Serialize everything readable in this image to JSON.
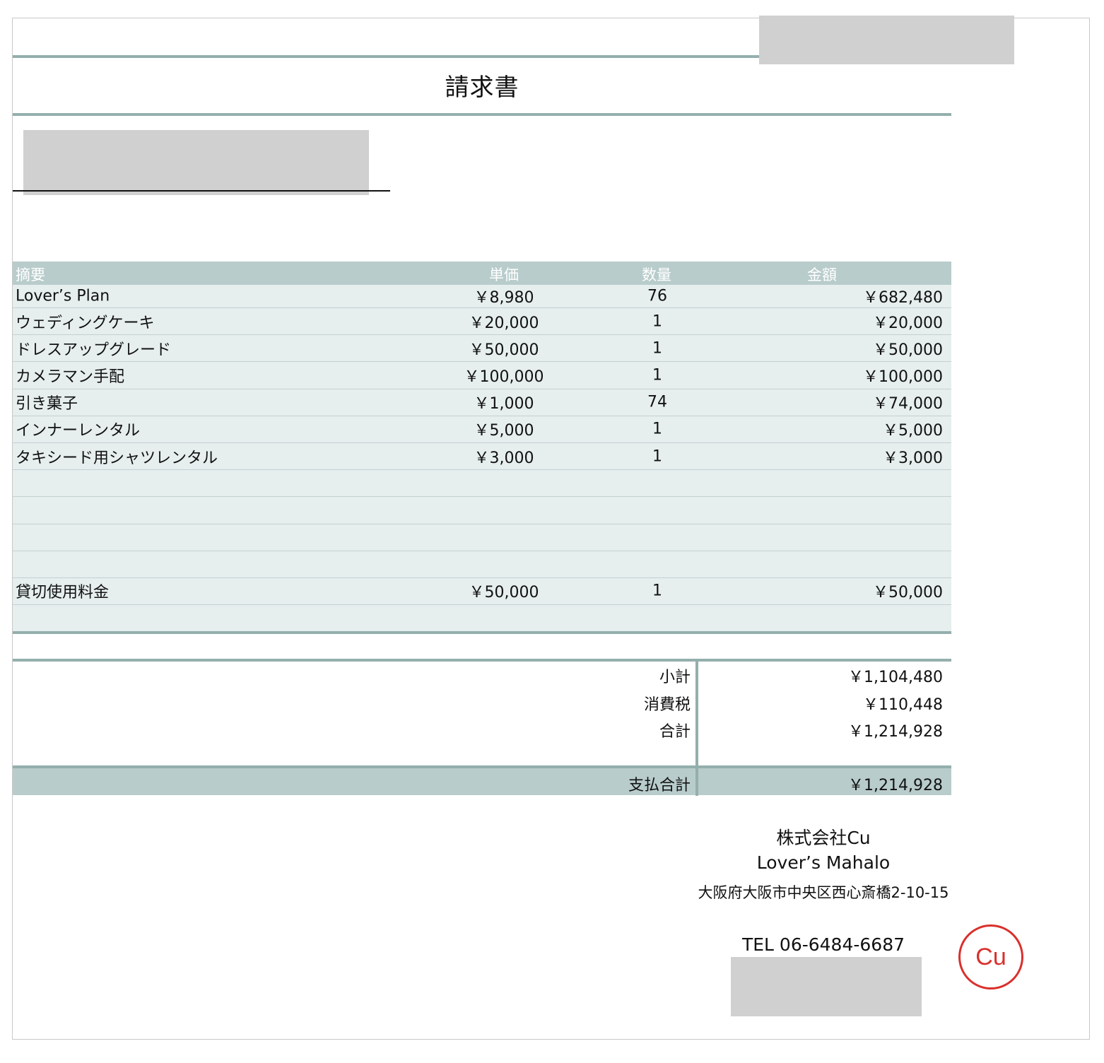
{
  "document": {
    "title": "請求書"
  },
  "table": {
    "headers": {
      "description": "摘要",
      "unit_price": "単価",
      "quantity": "数量",
      "amount": "金額"
    },
    "rows": [
      {
        "description": "Lover’s Plan",
        "unit_price": "￥8,980",
        "quantity": "76",
        "amount": "￥682,480"
      },
      {
        "description": "ウェディングケーキ",
        "unit_price": "￥20,000",
        "quantity": "1",
        "amount": "￥20,000"
      },
      {
        "description": "ドレスアップグレード",
        "unit_price": "￥50,000",
        "quantity": "1",
        "amount": "￥50,000"
      },
      {
        "description": "カメラマン手配",
        "unit_price": "￥100,000",
        "quantity": "1",
        "amount": "￥100,000"
      },
      {
        "description": "引き菓子",
        "unit_price": "￥1,000",
        "quantity": "74",
        "amount": "￥74,000"
      },
      {
        "description": "インナーレンタル",
        "unit_price": "￥5,000",
        "quantity": "1",
        "amount": "￥5,000"
      },
      {
        "description": "タキシード用シャツレンタル",
        "unit_price": "￥3,000",
        "quantity": "1",
        "amount": "￥3,000"
      },
      {
        "description": "",
        "unit_price": "",
        "quantity": "",
        "amount": ""
      },
      {
        "description": "",
        "unit_price": "",
        "quantity": "",
        "amount": ""
      },
      {
        "description": "",
        "unit_price": "",
        "quantity": "",
        "amount": ""
      },
      {
        "description": "",
        "unit_price": "",
        "quantity": "",
        "amount": ""
      },
      {
        "description": "貸切使用料金",
        "unit_price": "￥50,000",
        "quantity": "1",
        "amount": "￥50,000"
      },
      {
        "description": "",
        "unit_price": "",
        "quantity": "",
        "amount": ""
      }
    ]
  },
  "summary": {
    "subtotal_label": "小計",
    "subtotal": "￥1,104,480",
    "tax_label": "消費税",
    "tax": "￥110,448",
    "total_label": "合計",
    "total": "￥1,214,928",
    "payment_total_label": "支払合計",
    "payment_total": "￥1,214,928"
  },
  "company": {
    "name": "株式会社Cu",
    "brand": "Lover’s Mahalo",
    "address": "大阪府大阪市中央区西心斎橋2-10-15",
    "tel": "TEL 06-6484-6687",
    "seal_text": "Cu",
    "seal_color": "#d9302b"
  },
  "colors": {
    "accent_line": "#94afad",
    "header_fill": "#b8cccb",
    "row_fill": "#e6eeee"
  }
}
